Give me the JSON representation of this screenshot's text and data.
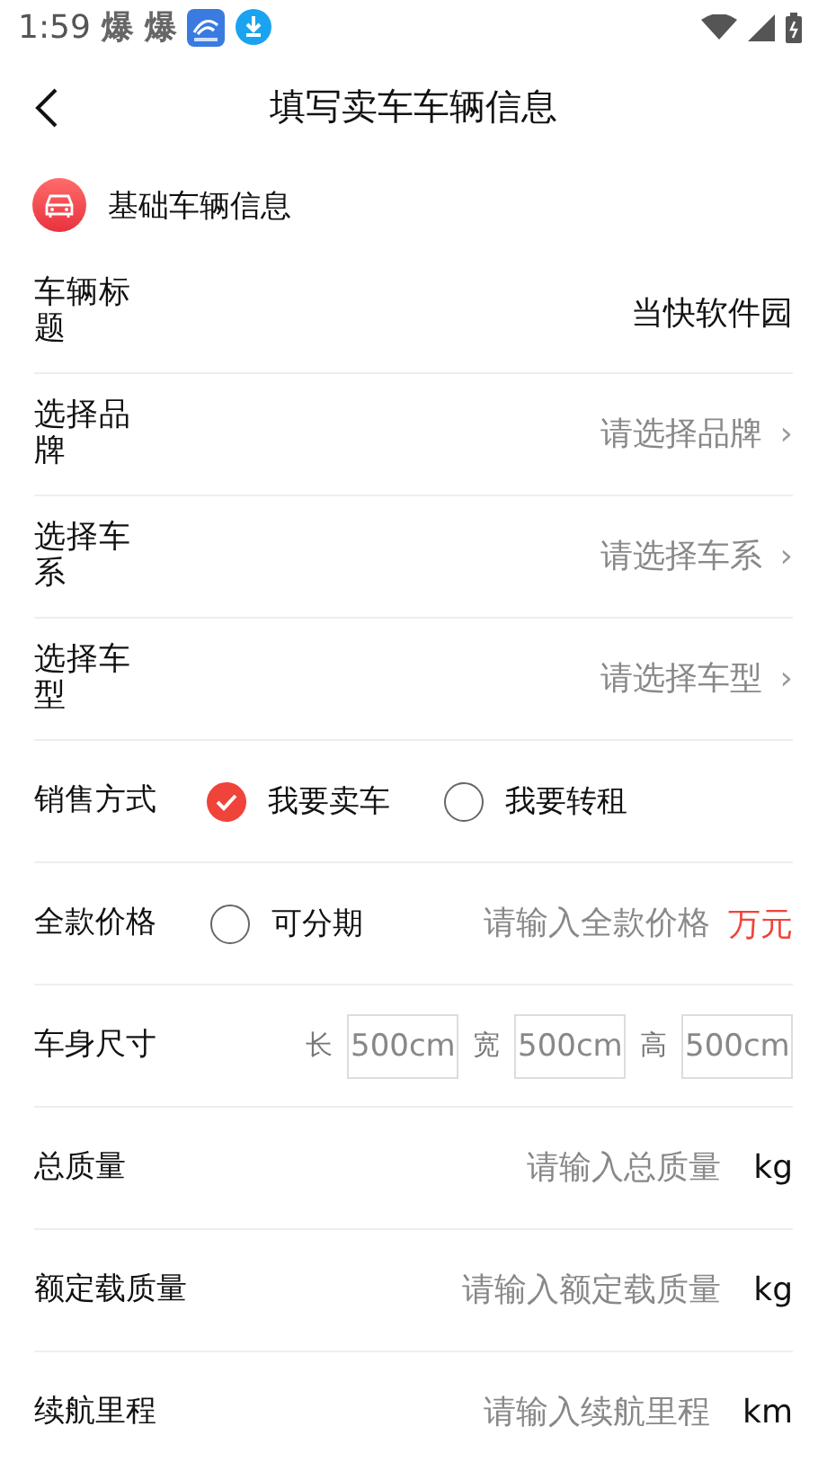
{
  "status_bar": {
    "time": "1:59",
    "notifications": [
      "爆",
      "爆"
    ]
  },
  "nav": {
    "title": "填写卖车车辆信息"
  },
  "section": {
    "title": "基础车辆信息"
  },
  "rows": [
    {
      "kind": "text",
      "label": "车辆标题",
      "value": "当快软件园"
    },
    {
      "kind": "select",
      "label": "选择品牌",
      "placeholder": "请选择品牌",
      "chevron": "›"
    },
    {
      "kind": "select",
      "label": "选择车系",
      "placeholder": "请选择车系",
      "chevron": "›"
    },
    {
      "kind": "select",
      "label": "选择车型",
      "placeholder": "请选择车型",
      "chevron": "›"
    },
    {
      "kind": "radio",
      "label": "销售方式",
      "options": [
        {
          "label": "我要卖车",
          "selected": true
        },
        {
          "label": "我要转租",
          "selected": false
        }
      ]
    },
    {
      "kind": "price",
      "label": "全款价格",
      "option": {
        "label": "可分期",
        "checked": false
      },
      "placeholder": "请输入全款价格",
      "unit": "万元"
    },
    {
      "kind": "dimensions",
      "label": "车身尺寸",
      "fields": [
        {
          "label": "长",
          "placeholder": "500cm"
        },
        {
          "label": "宽",
          "placeholder": "500cm"
        },
        {
          "label": "高",
          "placeholder": "500cm"
        }
      ]
    },
    {
      "kind": "unit",
      "label": "总质量",
      "placeholder": "请输入总质量",
      "unit": "kg"
    },
    {
      "kind": "unit",
      "label": "额定载质量",
      "placeholder": "请输入额定载质量",
      "unit": "kg"
    },
    {
      "kind": "unit",
      "label": "续航里程",
      "placeholder": "请输入续航里程",
      "unit": "km"
    }
  ]
}
